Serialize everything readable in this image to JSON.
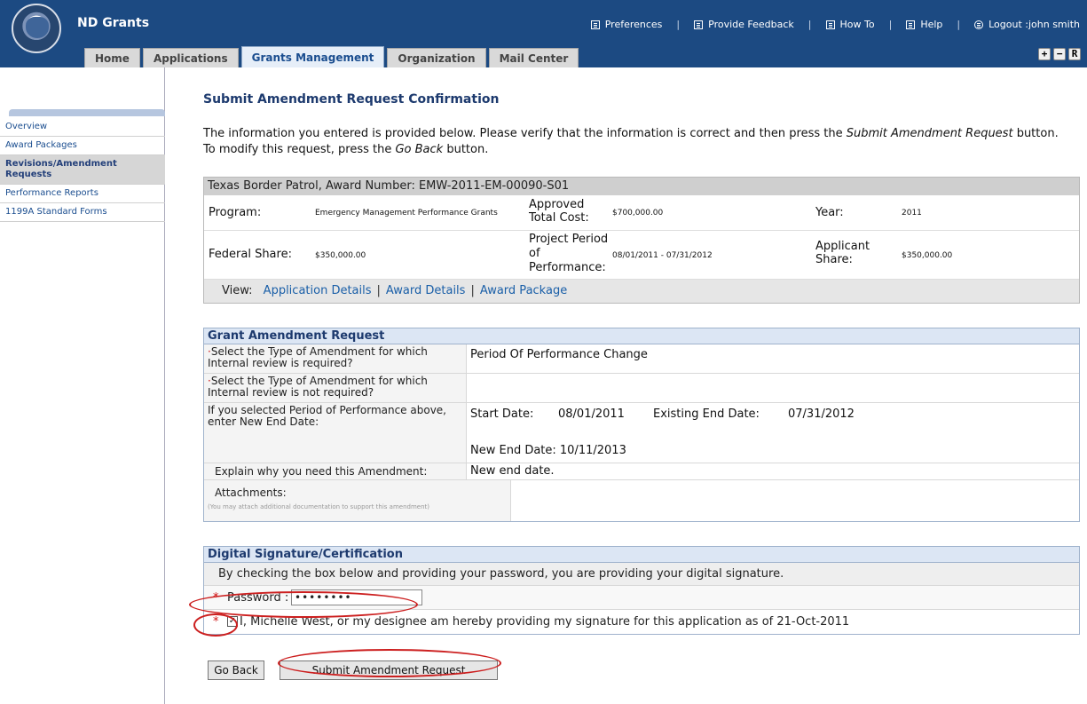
{
  "header": {
    "app_title": "ND Grants",
    "links": [
      {
        "label": "Preferences",
        "icon": "preferences-icon"
      },
      {
        "label": "Provide Feedback",
        "icon": "feedback-icon"
      },
      {
        "label": "How To",
        "icon": "how-to-icon"
      },
      {
        "label": "Help",
        "icon": "help-icon"
      },
      {
        "label": "Logout :john smith",
        "icon": "logout-icon"
      }
    ],
    "window_buttons": [
      "+",
      "−",
      "R"
    ]
  },
  "tabs": [
    {
      "label": "Home"
    },
    {
      "label": "Applications"
    },
    {
      "label": "Grants Management",
      "active": true
    },
    {
      "label": "Organization"
    },
    {
      "label": "Mail Center"
    }
  ],
  "sidebar": {
    "items": [
      {
        "label": "Overview"
      },
      {
        "label": "Award Packages"
      },
      {
        "label": "Revisions/Amendment Requests",
        "active": true
      },
      {
        "label": "Performance Reports"
      },
      {
        "label": "1199A Standard Forms"
      }
    ]
  },
  "page": {
    "title": "Submit Amendment Request Confirmation",
    "intro_before": "The information you entered is provided below. Please verify that the information is correct and then press the ",
    "intro_em1": "Submit Amendment Request",
    "intro_middle": " button. To modify this request, press the ",
    "intro_em2": "Go Back",
    "intro_after": " button."
  },
  "award": {
    "header": "Texas Border Patrol, Award Number: EMW-2011-EM-00090-S01",
    "program_label": "Program:",
    "program_value": "Emergency Management Performance Grants",
    "approved_label": "Approved Total Cost:",
    "approved_value": "$700,000.00",
    "year_label": "Year:",
    "year_value": "2011",
    "federal_label": "Federal Share:",
    "federal_value": "$350,000.00",
    "period_label": "Project Period of Performance:",
    "period_value": "08/01/2011 - 07/31/2012",
    "applicant_label": "Applicant Share:",
    "applicant_value": "$350,000.00",
    "view_label": "View:",
    "view_links": [
      "Application Details",
      "Award Details",
      "Award Package"
    ]
  },
  "amendment": {
    "header": "Grant Amendment Request",
    "q1": "Select the Type of Amendment for which Internal review is required?",
    "a1": "Period Of Performance Change",
    "q2": "Select the Type of Amendment for which Internal review is not required?",
    "a2": "",
    "q3": "If you selected Period of Performance above, enter New End Date:",
    "start_label": "Start Date:",
    "start_value": "08/01/2011",
    "existing_label": "Existing End Date:",
    "existing_value": "07/31/2012",
    "new_end": "New End Date: 10/11/2013",
    "q4": "Explain why you need this Amendment:",
    "a4": "New end date.",
    "attach_label": "Attachments:",
    "attach_note": "(You may attach additional documentation to support this amendment)"
  },
  "signature": {
    "header": "Digital Signature/Certification",
    "text": "By checking the box below and providing your password, you are providing your digital signature.",
    "required_mark": "*",
    "password_label": "Password :",
    "password_value": "••••••••",
    "checkbox_checked": true,
    "certify_text": "I, Michelle West, or my designee am hereby providing my signature for this application as of 21-Oct-2011"
  },
  "buttons": {
    "go_back": "Go Back",
    "submit": "Submit Amendment Request"
  },
  "colors": {
    "header_bg": "#1c4a82",
    "link": "#1a5fa8",
    "section_header": "#dce6f4",
    "annotation": "#cc1f1f"
  }
}
